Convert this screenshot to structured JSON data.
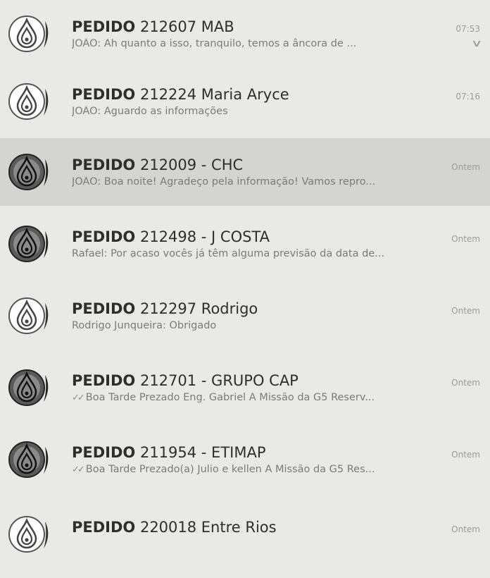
{
  "chats": [
    {
      "bold": "PEDIDO",
      "name": "212607 MAB",
      "preview": "JOÃO: Ah quanto a isso, tranquilo, temos a âncora de ...",
      "time": "07:53",
      "dark": false,
      "ticks": false,
      "chevron": true
    },
    {
      "bold": "PEDIDO",
      "name": "212224 Maria Aryce",
      "preview": "JOÃO: Aguardo as informações",
      "time": "07:16",
      "dark": false,
      "ticks": false,
      "chevron": false
    },
    {
      "bold": "PEDIDO",
      "name": "212009 - CHC",
      "preview": "JOÃO: Boa noite! Agradeço pela informação! Vamos repro...",
      "time": "Ontem",
      "dark": true,
      "ticks": false,
      "chevron": false
    },
    {
      "bold": "PEDIDO",
      "name": "212498 - J COSTA",
      "preview": "Rafael: Por acaso vocês já têm alguma previsão da data de...",
      "time": "Ontem",
      "dark": true,
      "ticks": false,
      "chevron": false
    },
    {
      "bold": "PEDIDO",
      "name": "212297 Rodrigo",
      "preview": "Rodrigo Junqueira: Obrigado",
      "time": "Ontem",
      "dark": false,
      "ticks": false,
      "chevron": false
    },
    {
      "bold": "PEDIDO",
      "name": "212701 - GRUPO CAP",
      "preview": "Boa Tarde Prezado Eng. Gabriel A Missão da G5 Reserv...",
      "time": "Ontem",
      "dark": true,
      "ticks": true,
      "chevron": false
    },
    {
      "bold": "PEDIDO",
      "name": "211954 - ETIMAP",
      "preview": "Boa Tarde Prezado(a) Julio e kellen A Missão da G5 Res...",
      "time": "Ontem",
      "dark": true,
      "ticks": true,
      "chevron": false
    },
    {
      "bold": "PEDIDO",
      "name": "220018 Entre Rios",
      "preview": "",
      "time": "Ontem",
      "dark": false,
      "ticks": false,
      "chevron": false
    }
  ],
  "icons": {
    "avatar": "water-drop-logo-icon",
    "chevron": "chevron-down-icon",
    "ticks": "double-check-icon"
  },
  "colors": {
    "background": "#e9e9e7",
    "selected": "#d4d4d2",
    "title": "#2e2e2e",
    "preview": "#7a7a7a",
    "time": "#9b9b9b",
    "avatar_dark": "#5a5a5a",
    "avatar_light": "#ffffff"
  }
}
